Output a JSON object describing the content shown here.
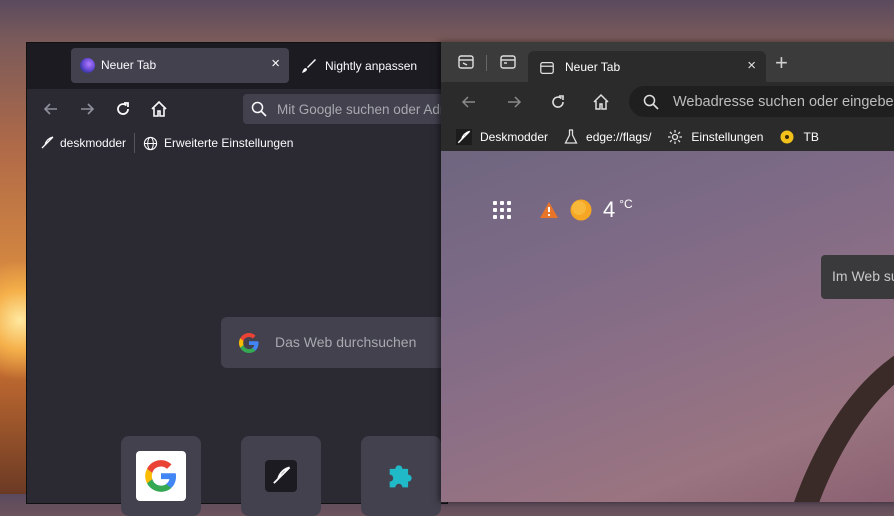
{
  "firefox": {
    "tabs": [
      {
        "title": "Neuer Tab",
        "close": "×"
      },
      {
        "title": "Nightly anpassen"
      }
    ],
    "url_placeholder": "Mit Google suchen oder Adresse eingeben",
    "bookmarks": [
      "deskmodder",
      "Erweiterte Einstellungen"
    ],
    "search_placeholder": "Das Web durchsuchen",
    "shortcut_tiles": [
      "google",
      "quill",
      "puzzle"
    ]
  },
  "edge": {
    "tab": {
      "title": "Neuer Tab",
      "close": "×"
    },
    "new_tab": "+",
    "url_placeholder": "Webadresse suchen oder eingeben",
    "bookmarks": [
      "Deskmodder",
      "edge://flags/",
      "Einstellungen",
      "TB"
    ],
    "weather": {
      "temp": "4",
      "unit": "°C"
    },
    "search_placeholder": "Im Web suchen"
  }
}
